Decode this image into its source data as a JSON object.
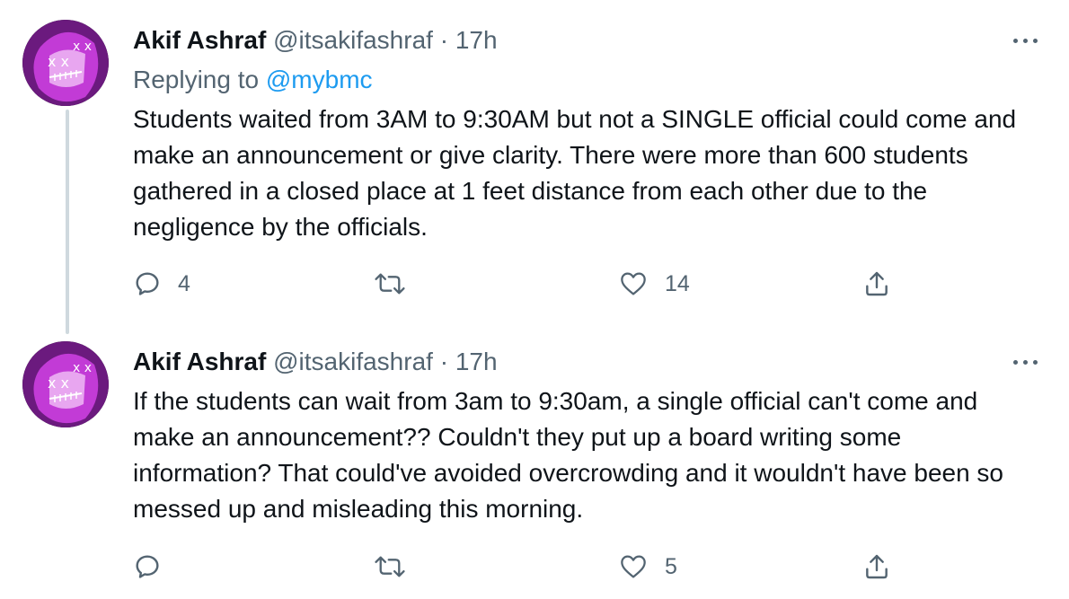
{
  "tweets": [
    {
      "author_name": "Akif Ashraf",
      "author_handle": "@itsakifashraf",
      "separator": "·",
      "time": "17h",
      "replying_prefix": "Replying to",
      "replying_handle": "@mybmc",
      "text": "Students waited from 3AM to 9:30AM but not a SINGLE official could come and make an announcement or give clarity. There were more than 600 students gathered in a closed place at 1 feet distance from each other due to the negligence by the officials.",
      "replies": "4",
      "retweets": "",
      "likes": "14"
    },
    {
      "author_name": "Akif Ashraf",
      "author_handle": "@itsakifashraf",
      "separator": "·",
      "time": "17h",
      "text": "If the students can wait from 3am to 9:30am, a single official can't come and make an announcement?? Couldn't they put up a board writing some information? That could've avoided overcrowding and it wouldn't have been so messed up and misleading this morning.",
      "replies": "",
      "retweets": "",
      "likes": "5"
    }
  ],
  "icons": {
    "more": "more-horizontal-icon",
    "reply": "reply-icon",
    "retweet": "retweet-icon",
    "like": "heart-icon",
    "share": "share-icon"
  },
  "colors": {
    "text": "#0f1419",
    "secondary": "#536471",
    "link": "#1d9bf0",
    "thread_line": "#cfd9de",
    "avatar_purple": "#c23bd6"
  }
}
